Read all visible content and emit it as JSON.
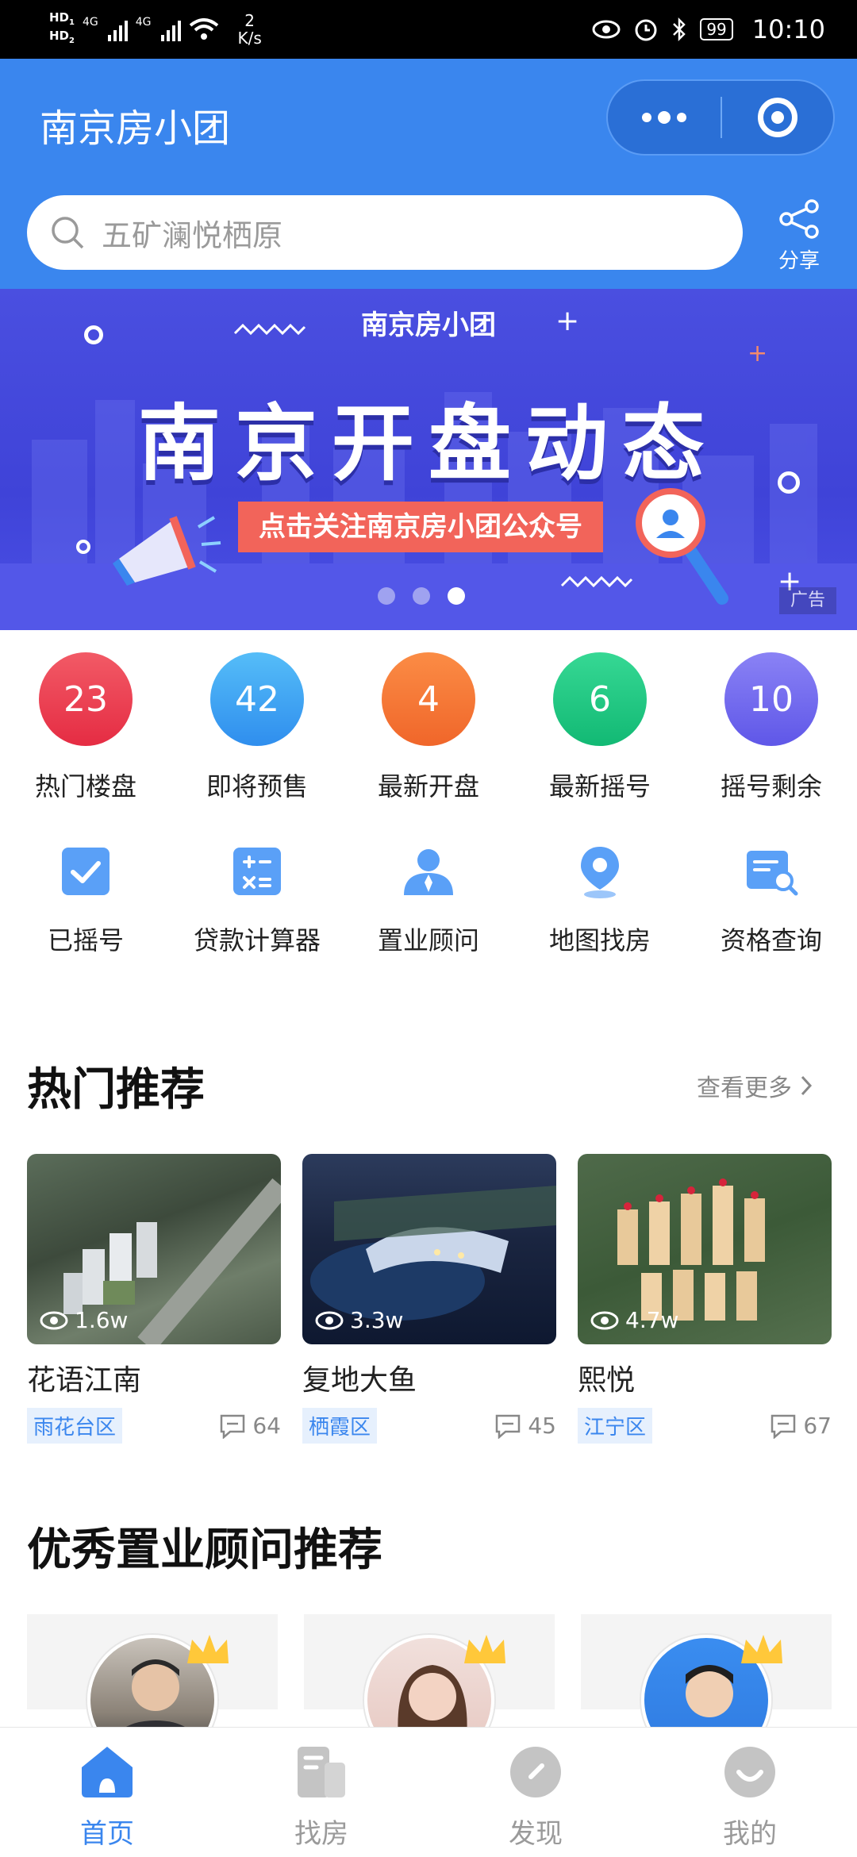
{
  "status_bar": {
    "hd1": "HD",
    "hd2": "HD",
    "sub1": "1",
    "sub2": "2",
    "net1": "4G",
    "net2": "4G",
    "speed_value": "2",
    "speed_unit": "K/s",
    "battery": "99",
    "time": "10:10"
  },
  "header": {
    "title": "南京房小团",
    "search_placeholder": "五矿澜悦栖原",
    "share_label": "分享"
  },
  "banner": {
    "brand": "南京房小团",
    "headline": "南京开盘动态",
    "cta": "点击关注南京房小团公众号",
    "ad_label": "广告",
    "active_slide": 3,
    "total_slides": 3
  },
  "stats": [
    {
      "value": "23",
      "label": "热门楼盘",
      "color": "#ec3b4f"
    },
    {
      "value": "42",
      "label": "即将预售",
      "color": "#3aa3f2"
    },
    {
      "value": "4",
      "label": "最新开盘",
      "color": "#f57a36"
    },
    {
      "value": "6",
      "label": "最新摇号",
      "color": "#1fc883"
    },
    {
      "value": "10",
      "label": "摇号剩余",
      "color": "#6f66ee"
    }
  ],
  "tools": [
    {
      "label": "已摇号",
      "icon": "checkbox-icon"
    },
    {
      "label": "贷款计算器",
      "icon": "calculator-icon"
    },
    {
      "label": "置业顾问",
      "icon": "advisor-icon"
    },
    {
      "label": "地图找房",
      "icon": "map-pin-icon"
    },
    {
      "label": "资格查询",
      "icon": "document-search-icon"
    }
  ],
  "hot": {
    "title": "热门推荐",
    "more": "查看更多",
    "items": [
      {
        "name": "花语江南",
        "views": "1.6w",
        "district": "雨花台区",
        "comments": "64"
      },
      {
        "name": "复地大鱼",
        "views": "3.3w",
        "district": "栖霞区",
        "comments": "45"
      },
      {
        "name": "熙悦",
        "views": "4.7w",
        "district": "江宁区",
        "comments": "67"
      }
    ]
  },
  "advisors": {
    "title": "优秀置业顾问推荐"
  },
  "tabbar": [
    {
      "label": "首页",
      "icon": "home-icon",
      "active": true
    },
    {
      "label": "找房",
      "icon": "find-house-icon",
      "active": false
    },
    {
      "label": "发现",
      "icon": "compass-icon",
      "active": false
    },
    {
      "label": "我的",
      "icon": "profile-icon",
      "active": false
    }
  ],
  "colors": {
    "primary": "#3a86ee",
    "banner": "#4a4fe0",
    "cta": "#f2645a"
  }
}
